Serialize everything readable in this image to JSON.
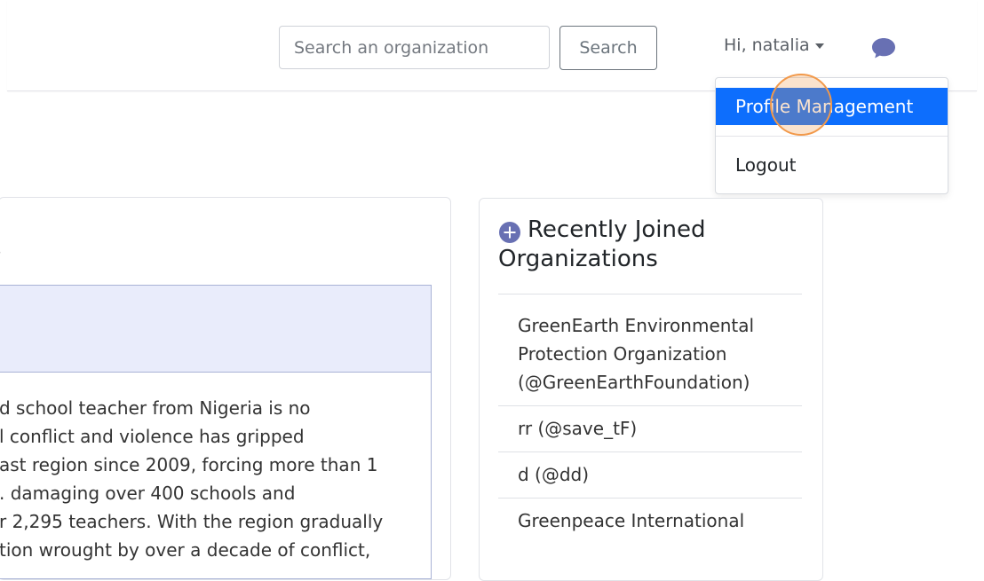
{
  "header": {
    "search": {
      "placeholder": "Search an organization",
      "button_label": "Search"
    },
    "user_greeting": "Hi, natalia",
    "chat_icon": "chat-bubble-icon"
  },
  "user_dropdown": {
    "items": [
      {
        "label": "Profile Management",
        "active": true
      },
      {
        "label": "Logout",
        "active": false
      }
    ]
  },
  "left_card": {
    "heading_fragment": "s",
    "post_text_lines": [
      "d school teacher from Nigeria is no",
      "l conflict and violence has gripped",
      "ast region since 2009, forcing more than 1",
      ". damaging over 400 schools and",
      "r 2,295 teachers. With the region gradually",
      "tion wrought by over a decade of conflict,"
    ]
  },
  "recent_orgs": {
    "title": "Recently Joined Organizations",
    "icon": "plus-circle-icon",
    "items": [
      {
        "label": "GreenEarth Environmental Protection Organization (@GreenEarthFoundation)"
      },
      {
        "label": "rr (@save_tF)"
      },
      {
        "label": "d (@dd)"
      },
      {
        "label": "Greenpeace International"
      }
    ]
  },
  "colors": {
    "accent": "#0d6efd",
    "icon_indigo": "#6870b3",
    "click_indicator": "#f2994a",
    "post_header_bg": "#e9ecfb"
  }
}
